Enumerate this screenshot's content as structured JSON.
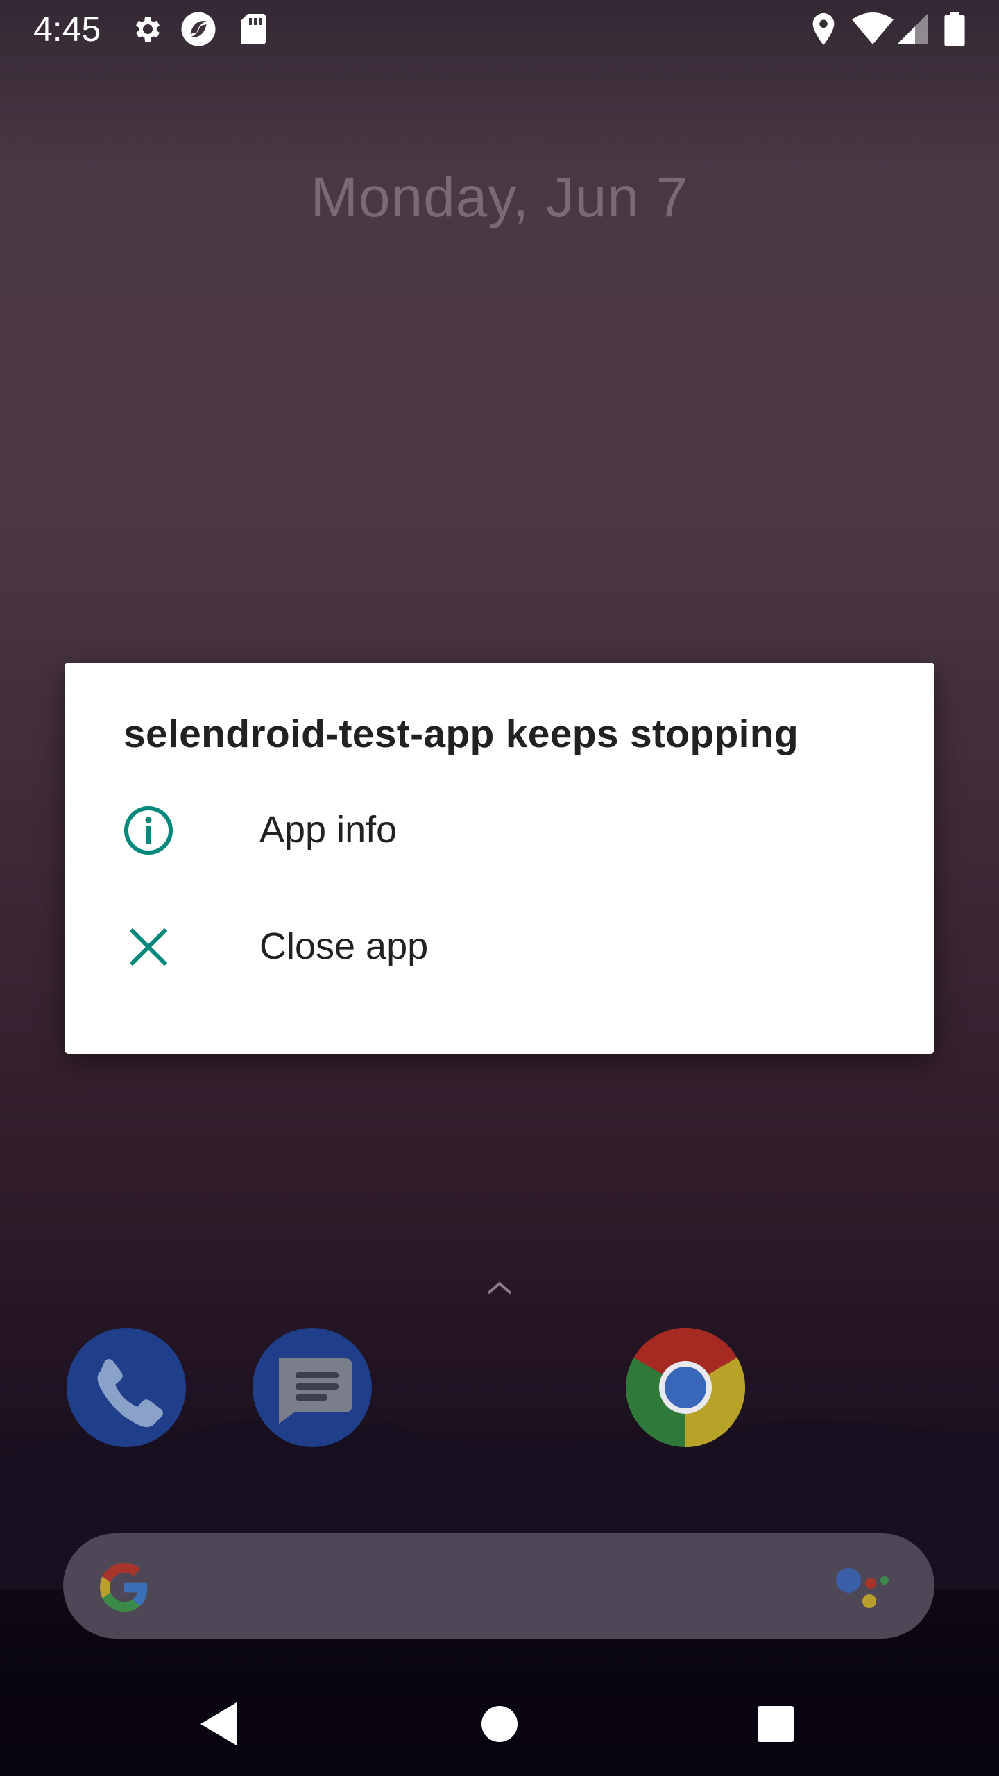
{
  "status_bar": {
    "time": "4:45",
    "left_icons": [
      "gear-icon",
      "app-notification-icon",
      "sd-card-icon"
    ],
    "right_icons": [
      "location-icon",
      "wifi-icon",
      "cell-signal-icon",
      "battery-icon"
    ]
  },
  "home": {
    "date": "Monday, Jun 7",
    "dock_apps": [
      "phone-app-icon",
      "messages-app-icon",
      "chrome-app-icon"
    ]
  },
  "dialog": {
    "title": "selendroid-test-app keeps stopping",
    "options": [
      {
        "icon": "info-icon",
        "label": "App info"
      },
      {
        "icon": "close-icon",
        "label": "Close app"
      }
    ],
    "accent_color": "#00897b"
  },
  "navbar": {
    "buttons": [
      "back-icon",
      "home-icon",
      "recents-icon"
    ]
  }
}
